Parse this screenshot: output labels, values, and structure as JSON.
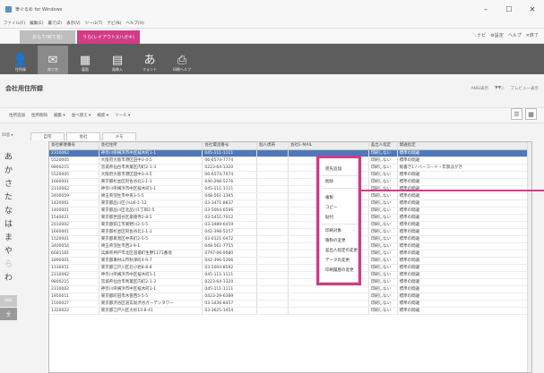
{
  "window": {
    "title": "筆ぐるめ for Windows",
    "controls": [
      "–",
      "☐",
      "✕"
    ]
  },
  "menu": [
    "ファイル(F)",
    "編集(E)",
    "裏で(Z)",
    "表示(V)",
    "ツール(T)",
    "ナビ(N)",
    "ヘルプ(H)"
  ],
  "tabs": {
    "tab1": "おもて(宛て名)",
    "tab2": "うら(レイアウト)(ハガキ)",
    "right_nav": [
      "＼ナビ",
      "⚙設定",
      "ヘルプ",
      "✕終了"
    ]
  },
  "ribbon": [
    {
      "icon": "address-book-icon",
      "glyph": "👤",
      "label": "住所録"
    },
    {
      "icon": "card-edit-icon",
      "glyph": "✉",
      "label": "宛て名"
    },
    {
      "icon": "layout-icon",
      "glyph": "▦",
      "label": "裏面"
    },
    {
      "icon": "image-icon",
      "glyph": "▤",
      "label": "画像入"
    },
    {
      "icon": "font-icon",
      "glyph": "あ",
      "label": "フォント"
    },
    {
      "icon": "print-icon",
      "glyph": "⎙",
      "label": "印刷ヘルプ"
    }
  ],
  "page": {
    "title": "会社用住所録",
    "right": [
      "ANSI表示",
      "▼▼△",
      "プレビュー表示"
    ]
  },
  "toolbar": [
    "住所追加",
    "住所削除",
    "編集 ▾",
    "並べ替え ▾",
    "検索 ▾",
    "ツール ▾"
  ],
  "left": {
    "header": "50音 ▾",
    "kana": [
      "あ",
      "か",
      "さ",
      "た",
      "な",
      "は",
      "ま",
      "や",
      "ら",
      "わ"
    ],
    "abc": "ABC",
    "all": "全"
  },
  "subtabs": [
    "自宅",
    "会社",
    "メモ"
  ],
  "columns": [
    "会社郵便番号",
    "会社住所",
    "会社電話番号",
    "個人携帯",
    "会社E-MAIL",
    "差出人指定",
    "間違指定"
  ],
  "rows": [
    [
      "2310062",
      "神奈川県横浜市中区桜木町1-1",
      "045-111-1111",
      "",
      "",
      "印刷しない",
      "標準の間違"
    ],
    [
      "5520005",
      "大阪府大阪市港区田中3-4-5",
      "06-6574-7774",
      "",
      "",
      "印刷しない",
      "標準の間違"
    ],
    [
      "9800215",
      "宮城県仙台市青葉区内町2-1-3",
      "0223-64-1320",
      "",
      "",
      "印刷しない",
      "縦書き1 / バーコード・年賀はがき"
    ],
    [
      "5520005",
      "大阪府大阪市港区田中3-4-5",
      "06-6574-7074",
      "",
      "",
      "印刷しない",
      "標準の間違"
    ],
    [
      "1660001",
      "東京都杉並区阿佐谷北1-1-1",
      "040-298-5276",
      "",
      "",
      "印刷しない",
      "標準の間違"
    ],
    [
      "2310062",
      "神奈川県横浜市中区桜木町1-1",
      "045-111-1111",
      "",
      "",
      "印刷しない",
      "標準の間違"
    ],
    [
      "3400059",
      "埼玉県羽生市中央3-5-5",
      "048-561-1395",
      "",
      "",
      "印刷しない",
      "標準の間違"
    ],
    [
      "1420061",
      "東京都品川区小山6-1-12",
      "03-3471-8837",
      "",
      "",
      "印刷しない",
      "標準の間違"
    ],
    [
      "1400001",
      "東京都品川区北品川1丁目2-5",
      "03-5064-6596",
      "",
      "",
      "印刷しない",
      "標準の間違"
    ],
    [
      "1540021",
      "東京都世田谷区豪徳寺2-8-5",
      "03-5451-7012",
      "",
      "",
      "印刷しない",
      "標準の間違"
    ],
    [
      "2010002",
      "東京都狛江市東野川2-5-5",
      "03-3489-6459",
      "",
      "",
      "印刷しない",
      "標準の間違"
    ],
    [
      "1660001",
      "東京都杉並区阿佐谷北1-1-1",
      "042-398-5257",
      "",
      "",
      "印刷しない",
      "標準の間違"
    ],
    [
      "1520001",
      "東京都目黒区中央町2-5-5",
      "03-0121-0472",
      "",
      "",
      "印刷しない",
      "標準の間違"
    ],
    [
      "3400054",
      "埼玉県羽生市西3-9-1",
      "048-561-7755",
      "",
      "",
      "印刷しない",
      "標準の間違"
    ],
    [
      "6681181",
      "兵庫県神戸市北区道場町生野1171番地",
      "0797-06-9080",
      "",
      "",
      "印刷しない",
      "標準の間違"
    ],
    [
      "1890001",
      "東京都東村山市秋津町4-9-7",
      "042-396-5266",
      "",
      "",
      "印刷しない",
      "標準の間違"
    ],
    [
      "1330051",
      "東京都江戸川区北小岩8-8-8",
      "03-5004-8592",
      "",
      "",
      "印刷しない",
      "標準の間違"
    ],
    [
      "2310062",
      "神奈川県横浜市中区桜木町1-1",
      "045-111-1111",
      "",
      "",
      "印刷しない",
      "標準の間違"
    ],
    [
      "9800215",
      "宮城県仙台市青葉区内町2-1-3",
      "0223-64-1320",
      "",
      "",
      "印刷しない",
      "標準の間違"
    ],
    [
      "2310062",
      "神奈川県横浜市中区桜木町1-1",
      "045-111-1111",
      "",
      "",
      "印刷しない",
      "標準の間違"
    ],
    [
      "1950011",
      "東京都町田市木曽西5-5-5",
      "0423-29-6389",
      "",
      "",
      "印刷しない",
      "標準の間違"
    ],
    [
      "1500027",
      "東京都渋谷区道玄坂渋谷ガーデンタワー",
      "03-3436-8457",
      "",
      "",
      "印刷しない",
      "標準の間違"
    ],
    [
      "1320022",
      "東京都江戸川区大杉13-8-41",
      "03-3625-1454",
      "",
      "",
      "印刷しない",
      "標準の間違"
    ]
  ],
  "selected_row": 0,
  "context_menu": {
    "items": [
      "宛先追加",
      "削除",
      "複製",
      "コピー",
      "貼付",
      "印刷対象",
      "敬称の変更",
      "差出人指定の変更",
      "データの変更",
      "印刷履歴の変更"
    ],
    "submenu_arrow": "›"
  },
  "highlight_color": "#d23b86"
}
